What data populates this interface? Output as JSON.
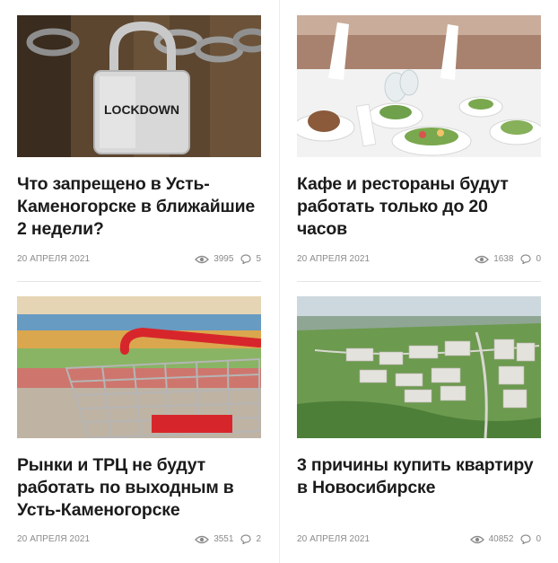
{
  "articles": [
    {
      "title": "Что запрещено в Усть-Каменогорске в ближайшие 2 недели?",
      "date": "20 АПРЕЛЯ 2021",
      "views": "3995",
      "comments": "5",
      "image": {
        "subject": "padlock on chain",
        "overlay_text": "LOCKDOWN"
      }
    },
    {
      "title": "Кафе и рестораны будут работать только до 20 часов",
      "date": "20 АПРЕЛЯ 2021",
      "views": "1638",
      "comments": "0",
      "image": {
        "subject": "restaurant table with dishes"
      }
    },
    {
      "title": "Рынки и ТРЦ не будут работать по выходным в Усть-Каменогорске",
      "date": "20 АПРЕЛЯ 2021",
      "views": "3551",
      "comments": "2",
      "image": {
        "subject": "shopping cart in store"
      }
    },
    {
      "title": "3 причины купить квартиру в Новосибирске",
      "date": "20 АПРЕЛЯ 2021",
      "views": "40852",
      "comments": "0",
      "image": {
        "subject": "aerial city view"
      }
    }
  ],
  "icons": {
    "views": "eye-icon",
    "comments": "comment-icon"
  },
  "colors": {
    "title": "#1b1b1b",
    "meta": "#8a8a8a",
    "divider": "#ececec"
  }
}
